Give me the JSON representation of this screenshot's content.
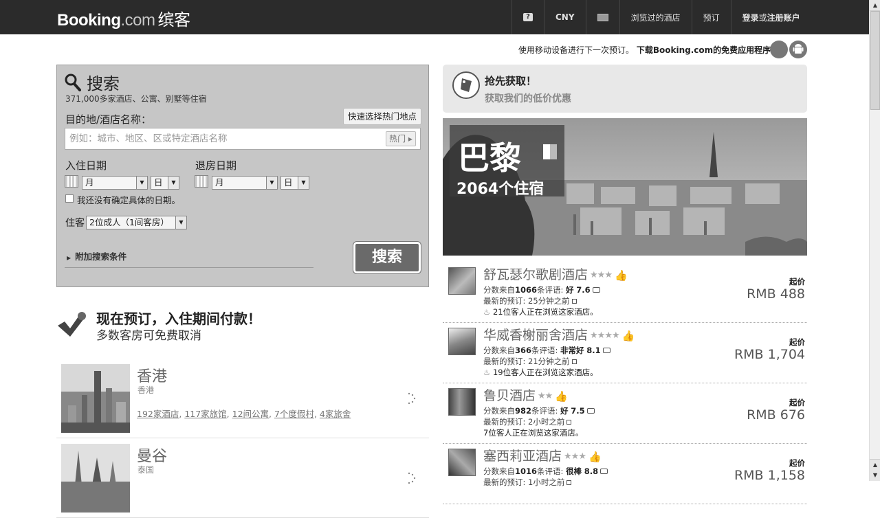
{
  "header": {
    "logo_main": "Booking",
    "logo_dotcom": ".com",
    "logo_cn": "缤客",
    "help_icon_label": "?",
    "currency": "CNY",
    "recent_hotels": "浏览过的酒店",
    "bookings": "预订",
    "login_a": "登录",
    "login_or": "或",
    "login_b": "注册账户"
  },
  "promo": {
    "text": "使用移动设备进行下一次预订。",
    "download": "下载Booking.com的免费应用程序"
  },
  "search": {
    "title": "搜索",
    "subtitle": "371,000多家酒店、公寓、别墅等住宿",
    "dest_label": "目的地/酒店名称：",
    "hot_tooltip": "快速选择热门地点",
    "dest_placeholder": "例如：城市、地区、区或特定酒店名称",
    "hot_button": "热门 ▸",
    "checkin_label": "入住日期",
    "checkout_label": "退房日期",
    "month_option": "月",
    "day_option": "日",
    "no_dates_label": "我还没有确定具体的日期。",
    "guests_label": "住客",
    "guests_value": "2位成人（1间客房）",
    "more_options": "附加搜索条件",
    "search_button": "搜索"
  },
  "paylater": {
    "title": "现在预订，入住期间付款！",
    "subtitle": "多数客房可免费取消"
  },
  "destinations": [
    {
      "name": "香港",
      "country": "香港",
      "links": [
        "192家酒店",
        "117家旅馆",
        "12间公寓",
        "7个度假村",
        "4家旅舍"
      ]
    },
    {
      "name": "曼谷",
      "country": "泰国",
      "links": []
    }
  ],
  "deal": {
    "title": "抢先获取！",
    "subtitle": "获取我们的低价优惠"
  },
  "featured_city": {
    "name": "巴黎",
    "count": "2064个住宿"
  },
  "hotels": [
    {
      "name": "舒瓦瑟尔歌剧酒店",
      "stars": "★★★",
      "review_prefix": "分数来自",
      "review_count": "1066",
      "review_mid": "条评语:",
      "rating_word": "好",
      "score": "7.6",
      "recent_label": "最新的预订:",
      "recent_time": "25分钟之前",
      "viewers": "21位客人正在浏览这家酒店。",
      "viewers_flame": true,
      "price_from": "起价",
      "price": "RMB 488"
    },
    {
      "name": "华威香榭丽舍酒店",
      "stars": "★★★★",
      "review_prefix": "分数来自",
      "review_count": "366",
      "review_mid": "条评语:",
      "rating_word": "非常好",
      "score": "8.1",
      "recent_label": "最新的预订:",
      "recent_time": "21分钟之前",
      "viewers": "19位客人正在浏览这家酒店。",
      "viewers_flame": true,
      "price_from": "起价",
      "price": "RMB 1,704"
    },
    {
      "name": "鲁贝酒店",
      "stars": "★★",
      "review_prefix": "分数来自",
      "review_count": "982",
      "review_mid": "条评语:",
      "rating_word": "好",
      "score": "7.5",
      "recent_label": "最新的预订:",
      "recent_time": "2小时之前",
      "viewers": "7位客人正在浏览这家酒店。",
      "viewers_flame": false,
      "price_from": "起价",
      "price": "RMB 676"
    },
    {
      "name": "塞西莉亚酒店",
      "stars": "★★★",
      "review_prefix": "分数来自",
      "review_count": "1016",
      "review_mid": "条评语:",
      "rating_word": "很棒",
      "score": "8.8",
      "recent_label": "最新的预订:",
      "recent_time": "1小时之前",
      "viewers": "",
      "viewers_flame": false,
      "price_from": "起价",
      "price": "RMB 1,158"
    }
  ]
}
